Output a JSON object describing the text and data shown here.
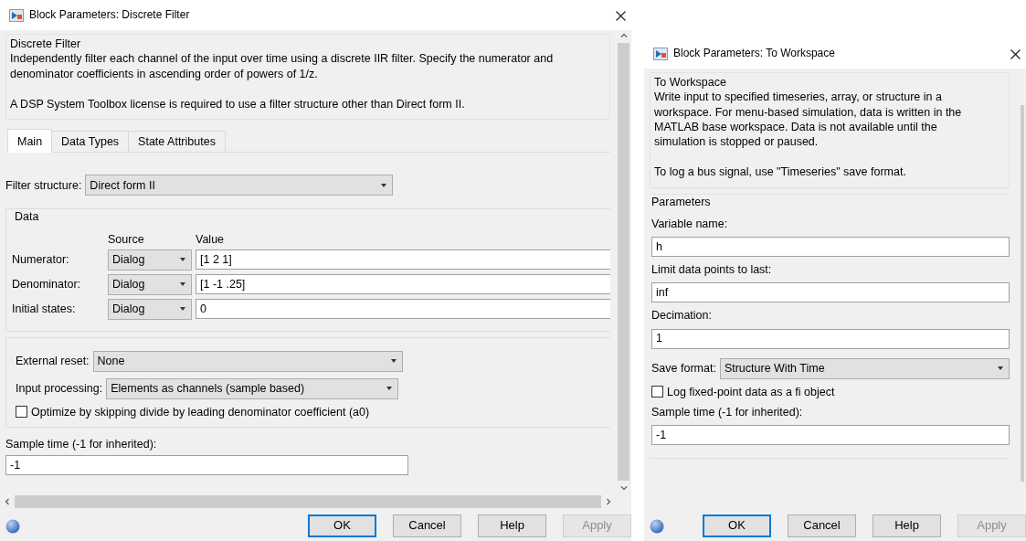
{
  "filter_dialog": {
    "title": "Block Parameters: Discrete Filter",
    "block_name": "Discrete Filter",
    "description": [
      "Independently filter each channel of the input over time using a discrete IIR filter. Specify the numerator and denominator coefficients in ascending order of powers of 1/z.",
      "A DSP System Toolbox license is required to use a filter structure other than Direct form II."
    ],
    "tabs": [
      {
        "label": "Main",
        "selected": true
      },
      {
        "label": "Data Types",
        "selected": false
      },
      {
        "label": "State Attributes",
        "selected": false
      }
    ],
    "filter_structure": {
      "label": "Filter structure:",
      "value": "Direct form II"
    },
    "data_group": {
      "title": "Data",
      "columns": [
        "Source",
        "Value"
      ],
      "rows": [
        {
          "label": "Numerator:",
          "source": "Dialog",
          "value": "[1 2 1]"
        },
        {
          "label": "Denominator:",
          "source": "Dialog",
          "value": "[1 -1 .25]"
        },
        {
          "label": "Initial states:",
          "source": "Dialog",
          "value": "0"
        }
      ]
    },
    "external_reset": {
      "label": "External reset:",
      "value": "None"
    },
    "input_processing": {
      "label": "Input processing:",
      "value": "Elements as channels (sample based)"
    },
    "optimize": {
      "label": "Optimize by skipping divide by leading denominator coefficient (a0)",
      "checked": false
    },
    "sample_time": {
      "label": "Sample time (-1 for inherited):",
      "value": "-1"
    },
    "buttons": [
      {
        "label": "OK",
        "default": true,
        "disabled": false
      },
      {
        "label": "Cancel",
        "default": false,
        "disabled": false
      },
      {
        "label": "Help",
        "default": false,
        "disabled": false
      },
      {
        "label": "Apply",
        "default": false,
        "disabled": true
      }
    ]
  },
  "workspace_dialog": {
    "title": "Block Parameters: To Workspace",
    "block_name": "To Workspace",
    "description": [
      "Write input to specified timeseries, array, or structure in a workspace. For menu-based simulation, data is written in the MATLAB base workspace. Data is not available until the simulation is stopped or paused.",
      "To log a bus signal, use \"Timeseries\" save format."
    ],
    "params_title": "Parameters",
    "fields": [
      {
        "kind": "text",
        "label": "Variable name:",
        "value": "h"
      },
      {
        "kind": "text",
        "label": "Limit data points to last:",
        "value": "inf"
      },
      {
        "kind": "text",
        "label": "Decimation:",
        "value": "1"
      },
      {
        "kind": "select",
        "label": "Save format:",
        "value": "Structure With Time"
      },
      {
        "kind": "checkbox",
        "label": "Log fixed-point data as a fi object",
        "checked": false
      },
      {
        "kind": "text",
        "label": "Sample time (-1 for inherited):",
        "value": "-1"
      }
    ],
    "buttons": [
      {
        "label": "OK",
        "default": true,
        "disabled": false
      },
      {
        "label": "Cancel",
        "default": false,
        "disabled": false
      },
      {
        "label": "Help",
        "default": false,
        "disabled": false
      },
      {
        "label": "Apply",
        "default": false,
        "disabled": true
      }
    ]
  }
}
